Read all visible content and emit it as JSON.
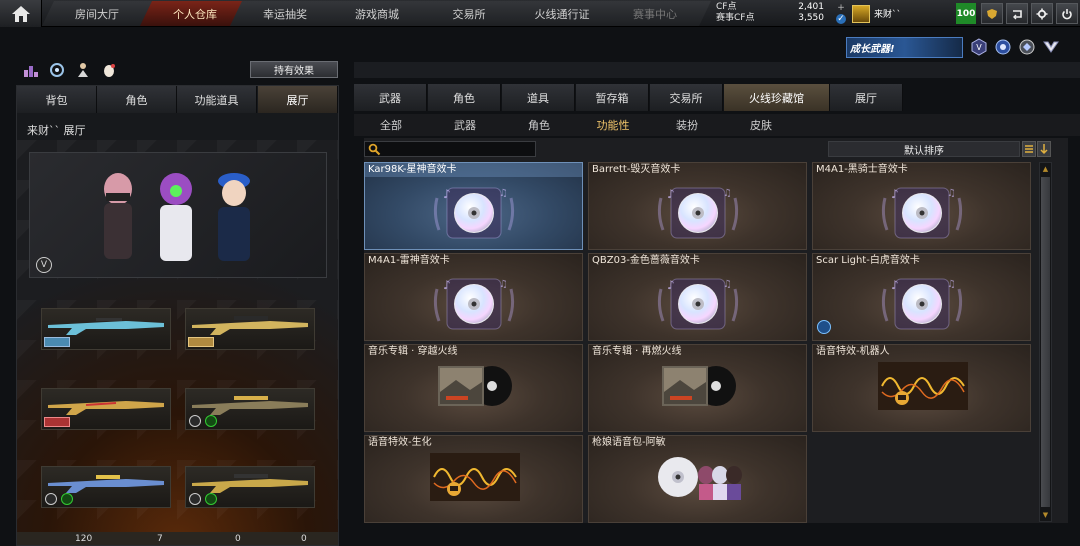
{
  "nav": {
    "tabs": [
      {
        "label": "房间大厅"
      },
      {
        "label": "个人仓库"
      },
      {
        "label": "幸运抽奖"
      },
      {
        "label": "游戏商城"
      },
      {
        "label": "交易所"
      },
      {
        "label": "火线通行证"
      },
      {
        "label": "赛事中心"
      }
    ],
    "active_index": 1
  },
  "currency": {
    "cf_label": "CF点",
    "cf_value": "2,401",
    "match_label": "赛事CF点",
    "match_value": "3,550"
  },
  "user": {
    "name": "来财``",
    "level": "100"
  },
  "promo": {
    "banner_text": "成长武器!"
  },
  "left_panel": {
    "effect_button": "持有效果",
    "tabs": [
      "背包",
      "角色",
      "功能道具",
      "展厅"
    ],
    "active_tab": 3,
    "title": "来财`` 展厅",
    "stats": [
      "120",
      "7",
      "0",
      "0"
    ]
  },
  "right_panel": {
    "tabs": [
      "武器",
      "角色",
      "道具",
      "暂存箱",
      "交易所",
      "火线珍藏馆",
      "展厅"
    ],
    "active_tab": 5,
    "sub_tabs": [
      "全部",
      "武器",
      "角色",
      "功能性",
      "装扮",
      "皮肤"
    ],
    "active_sub_tab": 3,
    "search_placeholder": "",
    "sort_label": "默认排序"
  },
  "items": [
    {
      "title": "Kar98K-星神音效卡",
      "kind": "disc",
      "selected": true
    },
    {
      "title": "Barrett-毁灭音效卡",
      "kind": "disc"
    },
    {
      "title": "M4A1-黑骑士音效卡",
      "kind": "disc"
    },
    {
      "title": "M4A1-雷神音效卡",
      "kind": "disc"
    },
    {
      "title": "QBZ03-金色蔷薇音效卡",
      "kind": "disc"
    },
    {
      "title": "Scar Light-白虎音效卡",
      "kind": "disc"
    },
    {
      "title": "音乐专辑 · 穿越火线",
      "kind": "album"
    },
    {
      "title": "音乐专辑 · 再燃火线",
      "kind": "album"
    },
    {
      "title": "语音特效-机器人",
      "kind": "wave"
    },
    {
      "title": "语音特效-生化",
      "kind": "wave"
    },
    {
      "title": "枪娘语音包-阿敏",
      "kind": "voicepack"
    }
  ],
  "colors": {
    "accent_gold": "#f2c66b",
    "active_nav": "#7a2418",
    "level_green": "#1f8a28"
  }
}
